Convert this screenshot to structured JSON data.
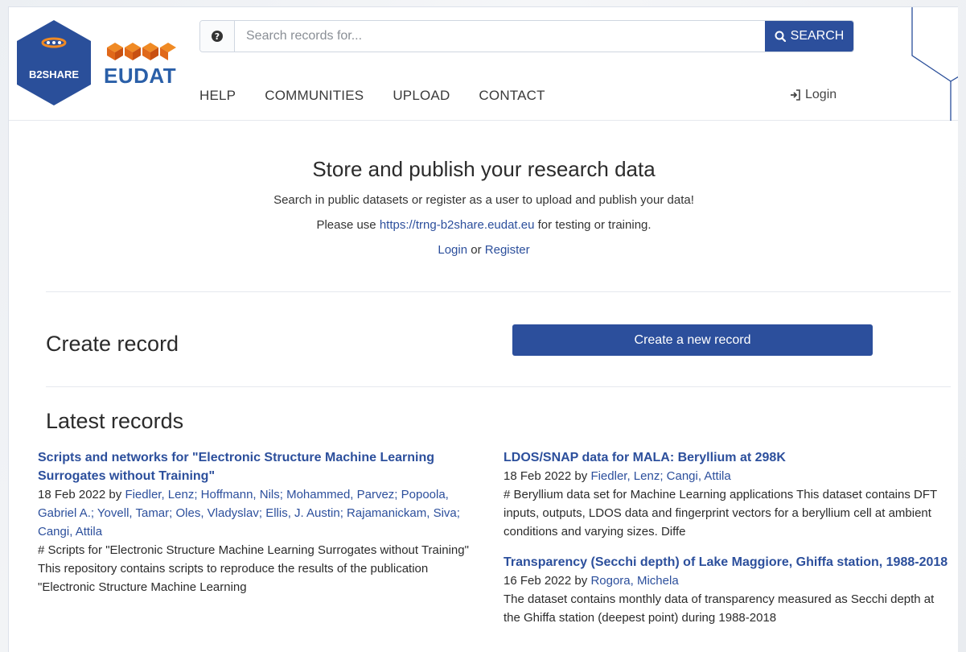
{
  "header": {
    "logo": {
      "b2share_text": "B2SHARE",
      "eudat_text": "EUDAT"
    },
    "search": {
      "placeholder": "Search records for...",
      "button_label": "SEARCH"
    },
    "nav": [
      "HELP",
      "COMMUNITIES",
      "UPLOAD",
      "CONTACT"
    ],
    "login_label": "Login"
  },
  "hero": {
    "title": "Store and publish your research data",
    "subtitle": "Search in public datasets or register as a user to upload and publish your data!",
    "testing_prefix": "Please use",
    "testing_link": "https://trng-b2share.eudat.eu",
    "testing_suffix": "for testing or training.",
    "login_link": "Login",
    "or_text": "or",
    "register_link": "Register"
  },
  "create": {
    "title": "Create record",
    "button_label": "Create a new record"
  },
  "latest": {
    "title": "Latest records",
    "by_text": "by",
    "records": [
      {
        "title": "Scripts and networks for \"Electronic Structure Machine Learning Surrogates without Training\"",
        "date": "18 Feb 2022",
        "authors": "Fiedler, Lenz; Hoffmann, Nils; Mohammed, Parvez; Popoola, Gabriel A.; Yovell, Tamar; Oles, Vladyslav; Ellis, J. Austin; Rajamanickam, Siva; Cangi, Attila",
        "description": "# Scripts for \"Electronic Structure Machine Learning Surrogates without Training\" This repository contains scripts to reproduce the results of the publication \"Electronic Structure Machine Learning"
      },
      {
        "title": "LDOS/SNAP data for MALA: Beryllium at 298K",
        "date": "18 Feb 2022",
        "authors": "Fiedler, Lenz; Cangi, Attila",
        "description": "# Beryllium data set for Machine Learning applications This dataset contains DFT inputs, outputs, LDOS data and fingerprint vectors for a beryllium cell at ambient conditions and varying sizes. Diffe"
      },
      {
        "title": "Transparency (Secchi depth) of Lake Maggiore, Ghiffa station, 1988-2018",
        "date": "16 Feb 2022",
        "authors": "Rogora, Michela",
        "description": "The dataset contains monthly data of transparency measured as Secchi depth at the Ghiffa station (deepest point) during 1988-2018"
      }
    ]
  },
  "colors": {
    "accent": "#2c4f9c",
    "logo_hex": "#2a4f9a",
    "eudat_orange": "#f08a24"
  },
  "icons": {
    "help": "question-circle-icon",
    "search": "search-icon",
    "login": "sign-in-icon"
  }
}
